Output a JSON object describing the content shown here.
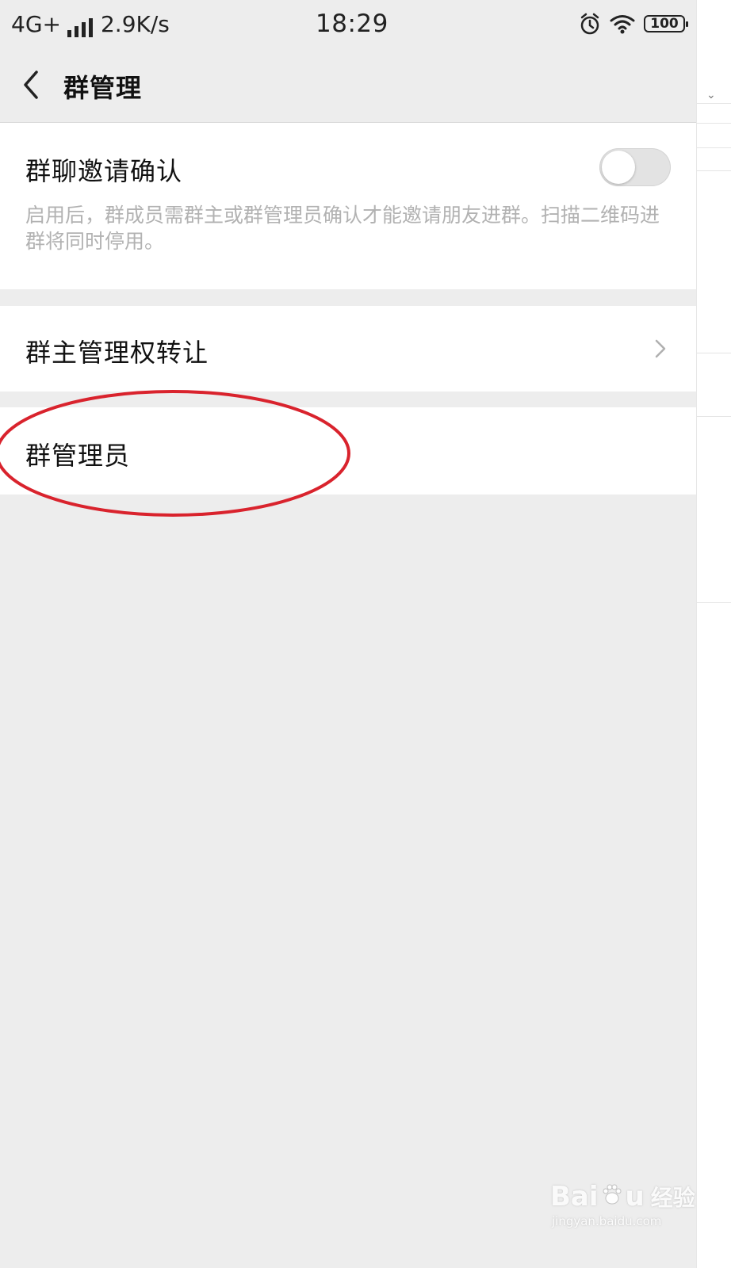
{
  "status_bar": {
    "network": "4G+",
    "speed": "2.9K/s",
    "time": "18:29",
    "battery": "100",
    "icons": [
      "signal-icon",
      "alarm-icon",
      "wifi-icon",
      "battery-icon"
    ]
  },
  "nav": {
    "back_icon": "chevron-left-icon",
    "title": "群管理"
  },
  "settings": {
    "invite_confirm": {
      "title": "群聊邀请确认",
      "description": "启用后，群成员需群主或群管理员确认才能邀请朋友进群。扫描二维码进群将同时停用。",
      "enabled": false
    },
    "owner_transfer": {
      "title": "群主管理权转让",
      "icon": "chevron-right-icon"
    },
    "admins": {
      "title": "群管理员"
    }
  },
  "annotation": {
    "color": "#d9232d",
    "shape": "ellipse-around-admins-row"
  },
  "watermark": {
    "brand": "Bai",
    "brand_suffix": "u",
    "brand_cn": "经验",
    "url": "jingyan.baidu.com"
  },
  "colors": {
    "background": "#ededed",
    "card": "#ffffff",
    "secondary_text": "#b2b2b2"
  }
}
